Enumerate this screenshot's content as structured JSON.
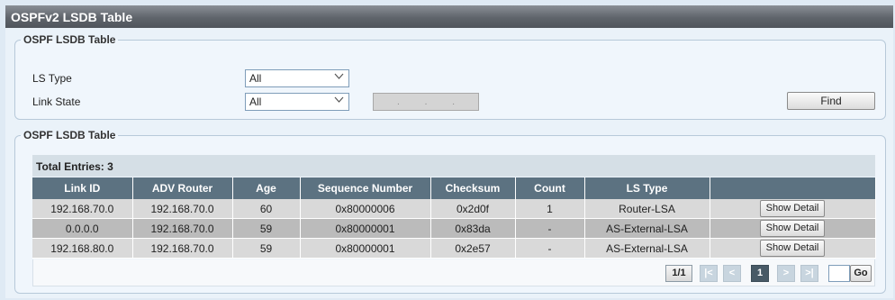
{
  "window": {
    "title": "OSPFv2 LSDB Table"
  },
  "filter": {
    "legend": "OSPF LSDB Table",
    "ls_type_label": "LS Type",
    "ls_type_value": "All",
    "link_state_label": "Link State",
    "link_state_value": "All",
    "ip_dots": [
      ".",
      ".",
      "."
    ],
    "find_label": "Find"
  },
  "results": {
    "legend": "OSPF LSDB Table",
    "total_entries": "Total Entries: 3",
    "columns": [
      "Link ID",
      "ADV Router",
      "Age",
      "Sequence Number",
      "Checksum",
      "Count",
      "LS Type",
      ""
    ],
    "rows": [
      {
        "link_id": "192.168.70.0",
        "adv_router": "192.168.70.0",
        "age": "60",
        "seq": "0x80000006",
        "checksum": "0x2d0f",
        "count": "1",
        "ls_type": "Router-LSA",
        "action": "Show Detail"
      },
      {
        "link_id": "0.0.0.0",
        "adv_router": "192.168.70.0",
        "age": "59",
        "seq": "0x80000001",
        "checksum": "0x83da",
        "count": "-",
        "ls_type": "AS-External-LSA",
        "action": "Show Detail"
      },
      {
        "link_id": "192.168.80.0",
        "adv_router": "192.168.70.0",
        "age": "59",
        "seq": "0x80000001",
        "checksum": "0x2e57",
        "count": "-",
        "ls_type": "AS-External-LSA",
        "action": "Show Detail"
      }
    ]
  },
  "pagination": {
    "page_info": "1/1",
    "first": "|<",
    "prev": "<",
    "current": "1",
    "next": ">",
    "last": ">|",
    "go_label": "Go",
    "goto_value": ""
  },
  "icons": {
    "dropdown": "chevron-down-icon"
  }
}
